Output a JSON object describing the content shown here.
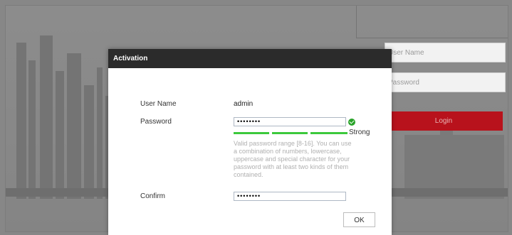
{
  "background": {
    "login": {
      "username_placeholder": "User Name",
      "password_placeholder": "Password",
      "login_label": "Login"
    }
  },
  "dialog": {
    "title": "Activation",
    "fields": {
      "username_label": "User Name",
      "username_value": "admin",
      "password_label": "Password",
      "password_mask": "••••••••",
      "confirm_label": "Confirm",
      "confirm_mask": "••••••••"
    },
    "strength": {
      "label": "Strong",
      "level_segments": 3,
      "total_segments": 3,
      "color": "#3cc93c"
    },
    "hint_text": "Valid password range [8-16]. You can use a combination of numbers, lowercase, uppercase and special character for your password with at least two kinds of them contained.",
    "ok_label": "OK"
  },
  "colors": {
    "title_bar": "#2b2b2b",
    "login_button": "#b8121c",
    "check_icon": "#29a329"
  },
  "icons": [
    "check-icon"
  ]
}
